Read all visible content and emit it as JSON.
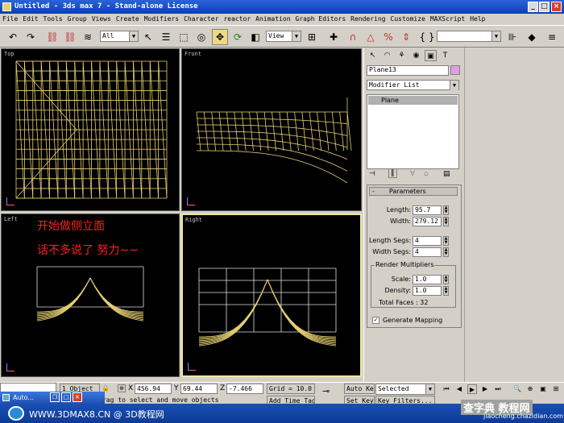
{
  "window": {
    "title": "Untitled - 3ds max 7  - Stand-alone License"
  },
  "menu": [
    "File",
    "Edit",
    "Tools",
    "Group",
    "Views",
    "Create",
    "Modifiers",
    "Character",
    "reactor",
    "Animation",
    "Graph Editors",
    "Rendering",
    "Customize",
    "MAXScript",
    "Help"
  ],
  "toolbar": {
    "selection_filter": "All",
    "ref_coord": "View"
  },
  "viewports": {
    "top": "Top",
    "front": "Front",
    "left": "Left",
    "right": "Right"
  },
  "annotation": {
    "line1": "开始做侧立面",
    "line2": "话不多说了   努力~~"
  },
  "command_panel": {
    "object_name": "Plane13",
    "modifier_list": "Modifier List",
    "stack_item": "Plane",
    "rollout_title": "Parameters",
    "length_label": "Length:",
    "length_value": "95.7",
    "width_label": "Width:",
    "width_value": "279.12",
    "length_segs_label": "Length Segs:",
    "length_segs_value": "4",
    "width_segs_label": "Width Segs:",
    "width_segs_value": "4",
    "render_group": "Render Multipliers",
    "scale_label": "Scale:",
    "scale_value": "1.0",
    "density_label": "Density:",
    "density_value": "1.0",
    "total_faces": "Total Faces : 32",
    "generate_mapping": "Generate Mapping"
  },
  "status": {
    "selected_count": "1 Object",
    "x_value": "456.94",
    "y_value": "69.44",
    "z_value": "-7.466",
    "grid": "Grid = 10.0",
    "auto_key": "Auto Key",
    "selected_dropdown": "Selected",
    "set_key": "Set Key",
    "key_filters": "Key Filters...",
    "prompt": "Click and drag to select and move objects",
    "add_time_tag": "Add Time Tag",
    "taskbar_item": "Auto..."
  },
  "footer": {
    "site_left": "WWW.3DMAX8.CN @ 3D教程网",
    "site_right_top": "查字典 教程网",
    "site_right_bottom": "jiaocheng.chazidian.com"
  },
  "colors": {
    "wire": "#e8d070",
    "annotation": "#ff2020",
    "title_bar": "#0a3fb8"
  }
}
